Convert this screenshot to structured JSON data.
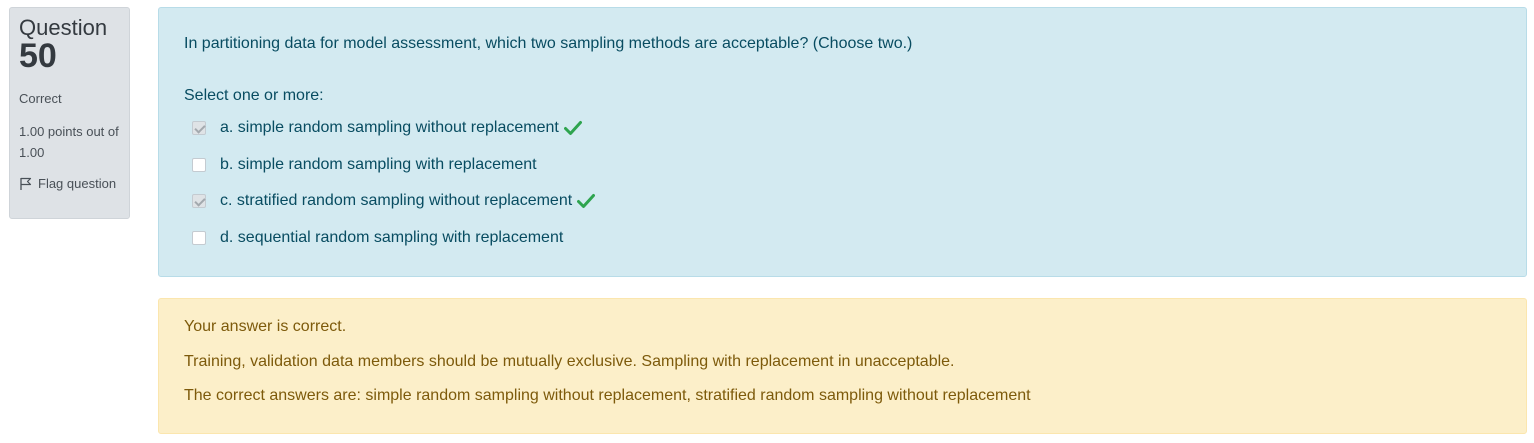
{
  "info": {
    "question_word": "Question",
    "question_number": "50",
    "state": "Correct",
    "grade": "1.00 points out of 1.00",
    "flag_label": "Flag question"
  },
  "formulation": {
    "question_text": "In partitioning data for model assessment, which two sampling methods are acceptable? (Choose two.)",
    "prompt": "Select one or more:",
    "answers": [
      {
        "label": "a. simple random sampling without replacement",
        "checked": true,
        "correct_mark": true
      },
      {
        "label": "b. simple random sampling with replacement",
        "checked": false,
        "correct_mark": false
      },
      {
        "label": "c. stratified random sampling without replacement",
        "checked": true,
        "correct_mark": true
      },
      {
        "label": "d. sequential random sampling with replacement",
        "checked": false,
        "correct_mark": false
      }
    ]
  },
  "feedback": {
    "result": "Your answer is correct.",
    "general": "Training, validation data members should be mutually exclusive. Sampling with replacement in unacceptable.",
    "right_answer": "The correct answers are: simple random sampling without replacement, stratified random sampling without replacement"
  },
  "colors": {
    "question_bg": "#d3eaf1",
    "question_text": "#084c61",
    "feedback_bg": "#fcefc9",
    "feedback_text": "#7d5a0b",
    "info_bg": "#dee2e6",
    "tick": "#2ea44f"
  }
}
